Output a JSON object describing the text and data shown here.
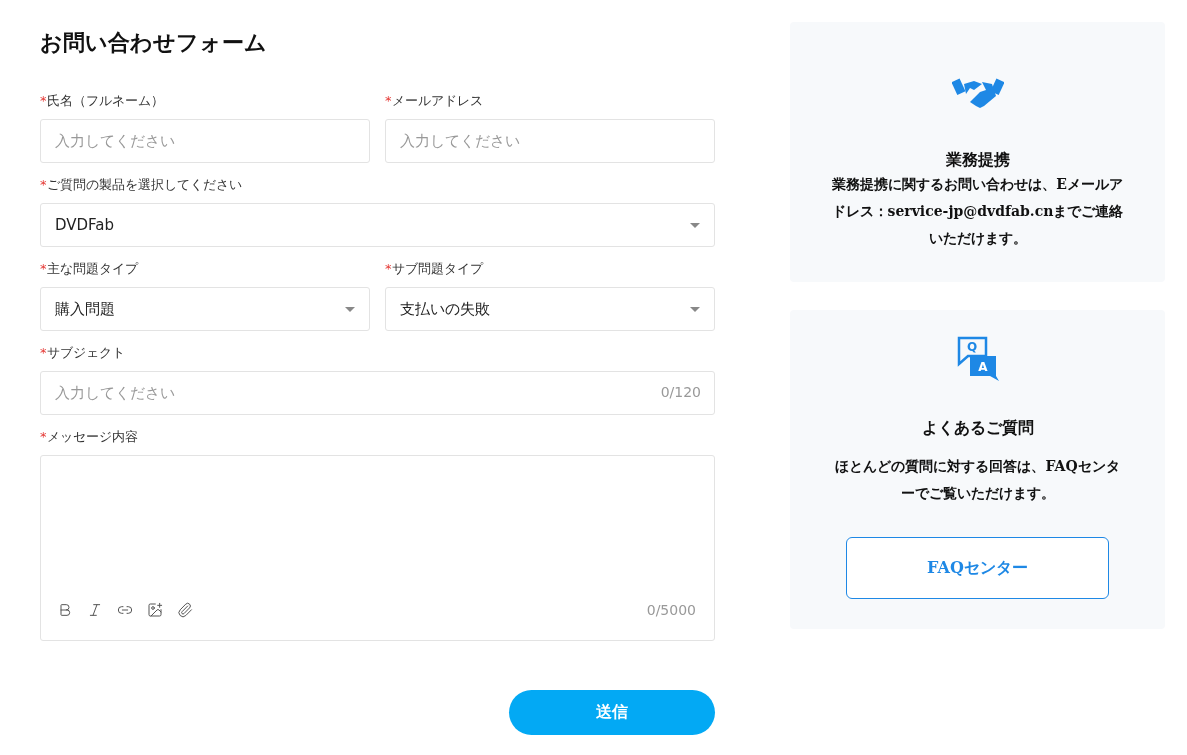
{
  "form": {
    "title": "お問い合わせフォーム",
    "rows": [
      [
        {
          "kind": "text",
          "required_mark": "*",
          "label": "氏名（フルネーム）",
          "placeholder": "入力してください"
        },
        {
          "kind": "text",
          "required_mark": "*",
          "label": "メールアドレス",
          "placeholder": "入力してください"
        }
      ],
      [
        {
          "kind": "select",
          "required_mark": "*",
          "label": "ご質問の製品を選択してください",
          "value": "DVDFab"
        }
      ],
      [
        {
          "kind": "select",
          "required_mark": "*",
          "label": "主な問題タイプ",
          "value": "購入問題"
        },
        {
          "kind": "select",
          "required_mark": "*",
          "label": "サブ問題タイプ",
          "value": "支払いの失敗"
        }
      ],
      [
        {
          "kind": "text",
          "required_mark": "*",
          "label": "サブジェクト",
          "placeholder": "入力してください",
          "counter": "0/120"
        }
      ],
      [
        {
          "kind": "textarea",
          "required_mark": "*",
          "label": "メッセージ内容",
          "counter": "0/5000"
        }
      ]
    ],
    "submit": "送信"
  },
  "cards": [
    {
      "kind": "partner",
      "title": "業務提携",
      "text": "業務提携に関するお問い合わせは、Eメールアドレス：service-jp@dvdfab.cnまでご連絡いただけます。"
    },
    {
      "kind": "faq",
      "icon_letters": [
        "Q",
        "A"
      ],
      "title": "よくあるご質問",
      "text": "ほとんどの質問に対する回答は、FAQセンターでご覧いただけます。",
      "button": "FAQセンター"
    }
  ]
}
